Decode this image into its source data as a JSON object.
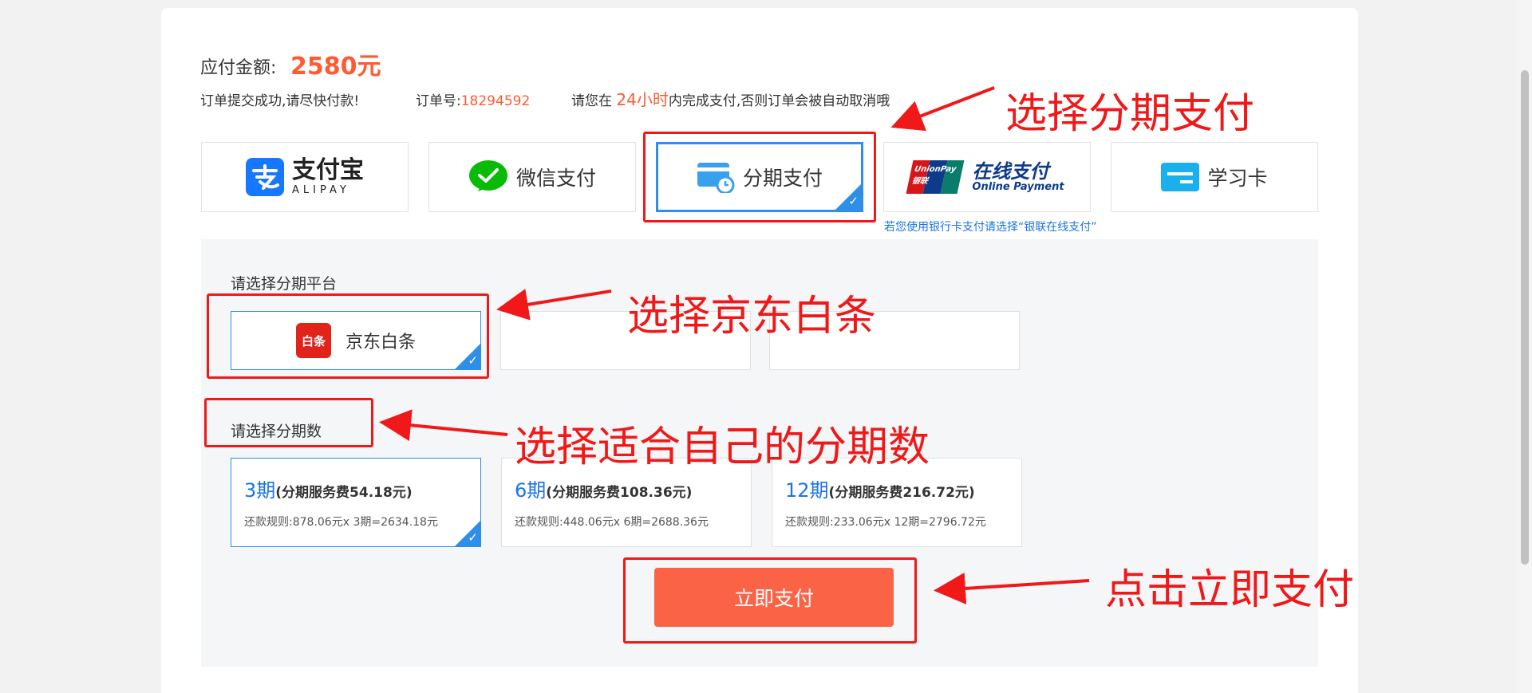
{
  "order": {
    "amount_label": "应付金额:",
    "amount_value": "2580元",
    "success_msg": "订单提交成功,请尽快付款!",
    "order_no_label": "订单号:",
    "order_no": "18294592",
    "deadline_prefix": "请您在",
    "deadline_value": "24小时",
    "deadline_suffix": "内完成支付,否则订单会被自动取消哦"
  },
  "payment_methods": [
    {
      "label": "支付宝",
      "sub": "ALIPAY",
      "icon": "alipay-icon"
    },
    {
      "label": "微信支付",
      "icon": "wechat-icon"
    },
    {
      "label": "分期支付",
      "icon": "installment-card-icon",
      "selected": true
    },
    {
      "label": "在线支付",
      "sub": "Online Payment",
      "badge": "UnionPay 银联",
      "icon": "unionpay-icon"
    },
    {
      "label": "学习卡",
      "icon": "study-card-icon"
    }
  ],
  "unionpay_hint": "若您使用银行卡支付请选择“银联在线支付”",
  "platform_section_title": "请选择分期平台",
  "platforms": [
    {
      "label": "京东白条",
      "logo_text": "白条",
      "selected": true
    }
  ],
  "period_section_title": "请选择分期数",
  "periods": [
    {
      "name": "3期",
      "fee": "(分期服务费54.18元)",
      "rule": "还款规则:878.06元x 3期=2634.18元",
      "selected": true
    },
    {
      "name": "6期",
      "fee": "(分期服务费108.36元)",
      "rule": "还款规则:448.06元x 6期=2688.36元"
    },
    {
      "name": "12期",
      "fee": "(分期服务费216.72元)",
      "rule": "还款规则:233.06元x 12期=2796.72元"
    }
  ],
  "pay_button_label": "立即支付",
  "annotations": {
    "choose_installment": "选择分期支付",
    "choose_jd": "选择京东白条",
    "choose_period": "选择适合自己的分期数",
    "click_pay": "点击立即支付"
  },
  "colors": {
    "accent_red": "#ff5a32",
    "selected_blue": "#2f8fe8",
    "annotation_red": "#f01818",
    "button": "#fa6346"
  }
}
